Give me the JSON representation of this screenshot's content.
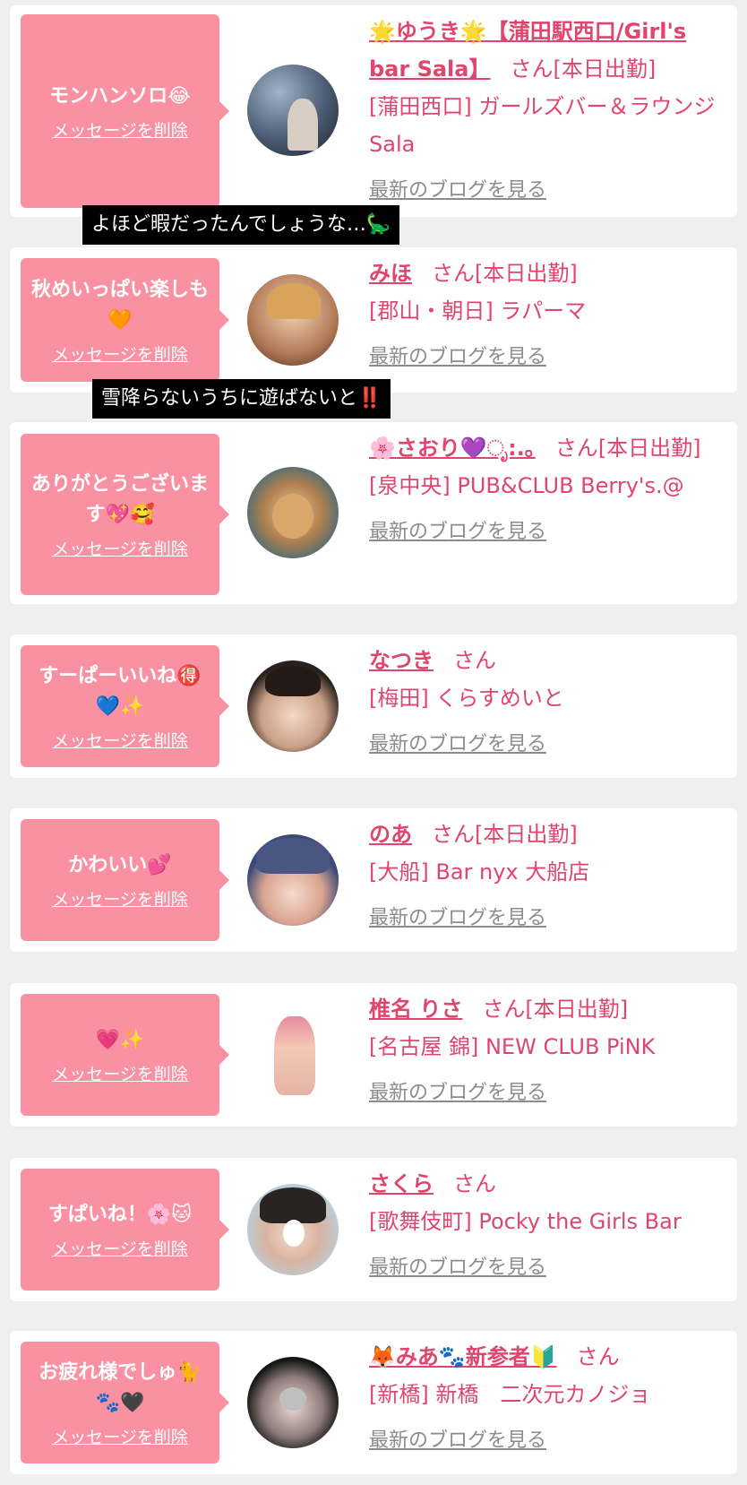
{
  "entries": [
    {
      "message": "モンハンソロ😂",
      "delete_label": "メッセージを削除",
      "name": "🌟ゆうき🌟【蒲田駅西口/Girl's bar Sala】",
      "san": "さん",
      "status": "[本日出勤]",
      "location": "[蒲田西口] ガールズバー＆ラウンジSala",
      "blog_label": "最新のブログを見る"
    },
    {
      "message": "秋めいっぱい楽しも🧡",
      "delete_label": "メッセージを削除",
      "name": "みほ",
      "san": "さん",
      "status": "[本日出勤]",
      "location": "[郡山・朝日] ラパーマ",
      "blog_label": "最新のブログを見る"
    },
    {
      "message": "ありがとうございます💖🥰",
      "delete_label": "メッセージを削除",
      "name": "🌸さおり💜ೃ:.｡",
      "san": "さん",
      "status": "[本日出勤]",
      "location": "[泉中央] PUB&CLUB Berry's.@",
      "blog_label": "最新のブログを見る"
    },
    {
      "message": "すーぱーいいね🉐💙✨",
      "delete_label": "メッセージを削除",
      "name": "なつき",
      "san": "さん",
      "status": "",
      "location": "[梅田] くらすめいと",
      "blog_label": "最新のブログを見る"
    },
    {
      "message": "かわいい💕",
      "delete_label": "メッセージを削除",
      "name": "のあ",
      "san": "さん",
      "status": "[本日出勤]",
      "location": "[大船] Bar nyx 大船店",
      "blog_label": "最新のブログを見る"
    },
    {
      "message": "💗✨",
      "delete_label": "メッセージを削除",
      "name": "椎名 りさ",
      "san": "さん",
      "status": "[本日出勤]",
      "location": "[名古屋 錦] NEW CLUB PiNK",
      "blog_label": "最新のブログを見る"
    },
    {
      "message": "すぱいね！🌸🐱",
      "delete_label": "メッセージを削除",
      "name": "さくら",
      "san": "さん",
      "status": "",
      "location": "[歌舞伎町] Pocky the Girls Bar",
      "blog_label": "最新のブログを見る"
    },
    {
      "message": "お疲れ様でしゅ🐈🐾🖤",
      "delete_label": "メッセージを削除",
      "name": "🦊みあ🐾新参者🔰",
      "san": "さん",
      "status": "",
      "location": "[新橋] 新橋　二次元カノジョ",
      "blog_label": "最新のブログを見る"
    }
  ],
  "tooltips": [
    "よほど暇だったんでしょうな…🦕",
    "雪降らないうちに遊ばないと‼️"
  ]
}
